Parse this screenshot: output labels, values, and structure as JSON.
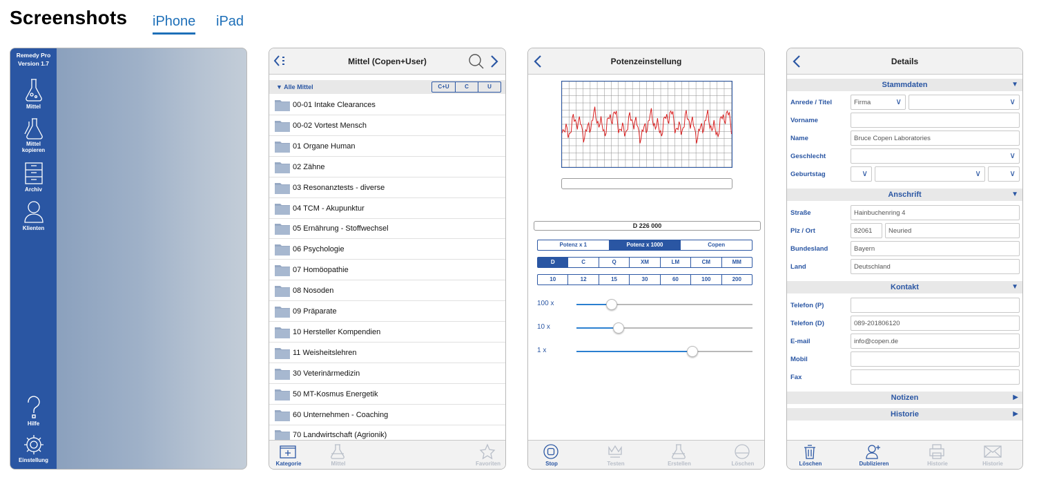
{
  "header": {
    "title": "Screenshots",
    "tabs": [
      {
        "label": "iPhone"
      },
      {
        "label": "iPad"
      }
    ]
  },
  "shot1": {
    "app_title": "Remedy Pro",
    "version": "Version 1.7",
    "items": [
      {
        "label": "Mittel",
        "icon": "flask-icon"
      },
      {
        "label": "Mittel kopieren",
        "icon": "flask-copy-icon"
      },
      {
        "label": "Archiv",
        "icon": "archive-icon"
      },
      {
        "label": "Klienten",
        "icon": "person-icon"
      },
      {
        "label": "Hilfe",
        "icon": "question-icon"
      },
      {
        "label": "Einstellung",
        "icon": "gear-icon"
      }
    ]
  },
  "shot2": {
    "title": "Mittel (Copen+User)",
    "filter_label": "▼ Alle Mittel",
    "segments": [
      "C+U",
      "C",
      "U"
    ],
    "rows": [
      "00-01 Intake Clearances",
      "00-02 Vortest Mensch",
      "01 Organe Human",
      "02 Zähne",
      "03 Resonanztests - diverse",
      "04 TCM - Akupunktur",
      "05 Ernährung - Stoffwechsel",
      "06 Psychologie",
      "07 Homöopathie",
      "08 Nosoden",
      "09 Präparate",
      "10 Hersteller Kompendien",
      "11 Weisheitslehren",
      "30 Veterinärmedizin",
      "50 MT-Kosmus Energetik",
      "60 Unternehmen - Coaching",
      "70 Landwirtschaft (Agrionik)"
    ],
    "tabbar": [
      {
        "label": "Kategorie",
        "icon": "add-folder-icon",
        "state": "on"
      },
      {
        "label": "Mittel",
        "icon": "flask-icon",
        "state": "dis"
      },
      {
        "label": "Favoriten",
        "icon": "star-icon",
        "state": "dis"
      }
    ]
  },
  "shot3": {
    "title": "Potenzeinstellung",
    "potency_display": "D 226 000",
    "mode_segments": [
      "Potenz x 1",
      "Potenz x 1000",
      "Copen"
    ],
    "mode_selected": 1,
    "scale_segments": [
      "D",
      "C",
      "Q",
      "XM",
      "LM",
      "CM",
      "MM"
    ],
    "scale_selected": 0,
    "value_segments": [
      "10",
      "12",
      "15",
      "30",
      "60",
      "100",
      "200"
    ],
    "sliders": [
      {
        "label": "100 x",
        "value": 0.2
      },
      {
        "label": "10  x",
        "value": 0.24
      },
      {
        "label": "1   x",
        "value": 0.66
      }
    ],
    "tabbar": [
      {
        "label": "Stop",
        "icon": "stop-icon",
        "state": "on"
      },
      {
        "label": "Testen",
        "icon": "crown-icon",
        "state": "dis"
      },
      {
        "label": "Erstellen",
        "icon": "flask-icon",
        "state": "dis"
      },
      {
        "label": "Löschen",
        "icon": "erase-icon",
        "state": "dis"
      }
    ]
  },
  "shot4": {
    "title": "Details",
    "sections": {
      "stammdaten": "Stammdaten",
      "anschrift": "Anschrift",
      "kontakt": "Kontakt",
      "notizen": "Notizen",
      "historie": "Historie"
    },
    "fields": {
      "anrede_label": "Anrede / Titel",
      "anrede_value": "Firma",
      "vorname_label": "Vorname",
      "name_label": "Name",
      "name_value": "Bruce Copen Laboratories",
      "geschlecht_label": "Geschlecht",
      "geburtstag_label": "Geburtstag",
      "strasse_label": "Straße",
      "strasse_value": "Hainbuchenring 4",
      "plz_label": "Plz / Ort",
      "plz_value": "82061",
      "ort_value": "Neuried",
      "bundesland_label": "Bundesland",
      "bundesland_value": "Bayern",
      "land_label": "Land",
      "land_value": "Deutschland",
      "telp_label": "Telefon (P)",
      "teld_label": "Telefon (D)",
      "teld_value": "089-201806120",
      "email_label": "E-mail",
      "email_value": "info@copen.de",
      "mobil_label": "Mobil",
      "fax_label": "Fax"
    },
    "tabbar": [
      {
        "label": "Löschen",
        "icon": "trash-icon",
        "state": "on"
      },
      {
        "label": "Dublizieren",
        "icon": "add-person-icon",
        "state": "on"
      },
      {
        "label": "Historie",
        "icon": "printer-icon",
        "state": "dis"
      },
      {
        "label": "Historie",
        "icon": "mail-icon",
        "state": "dis"
      }
    ]
  },
  "colors": {
    "accent": "#2a56a3",
    "link": "#1d6fb8"
  }
}
